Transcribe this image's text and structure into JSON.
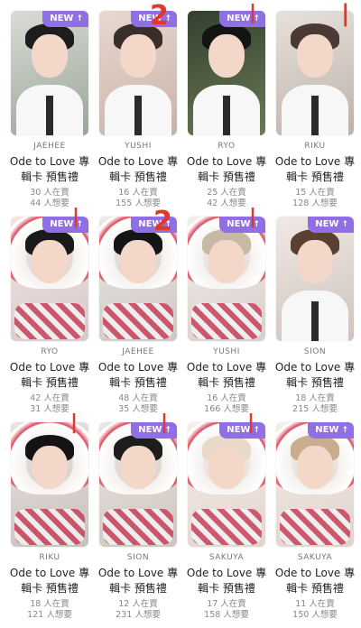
{
  "badge": {
    "label": "NEW",
    "icon": "arrow-up-icon",
    "color": "#8f6ee6"
  },
  "cards": [
    {
      "name": "JAEHEE",
      "title_line1": "Ode to Love 專",
      "title_line2": "輯卡 預售禮",
      "selling": "30 人在賣",
      "wanting": "44 人想要",
      "new": true
    },
    {
      "name": "YUSHI",
      "title_line1": "Ode to Love 專",
      "title_line2": "輯卡 預售禮",
      "selling": "16 人在賣",
      "wanting": "155 人想要",
      "new": true,
      "annotation": "2"
    },
    {
      "name": "RYO",
      "title_line1": "Ode to Love 專",
      "title_line2": "輯卡 預售禮",
      "selling": "25 人在賣",
      "wanting": "42 人想要",
      "new": true,
      "annotation": "|"
    },
    {
      "name": "RIKU",
      "title_line1": "Ode to Love 專",
      "title_line2": "輯卡 預售禮",
      "selling": "15 人在賣",
      "wanting": "128 人想要",
      "new": false,
      "annotation": "|"
    },
    {
      "name": "RYO",
      "title_line1": "Ode to Love 專",
      "title_line2": "輯卡 預售禮",
      "selling": "42 人在賣",
      "wanting": "31 人想要",
      "new": true,
      "annotation": "|"
    },
    {
      "name": "JAEHEE",
      "title_line1": "Ode to Love 專",
      "title_line2": "輯卡 預售禮",
      "selling": "48 人在賣",
      "wanting": "35 人想要",
      "new": true,
      "annotation": "2"
    },
    {
      "name": "YUSHI",
      "title_line1": "Ode to Love 專",
      "title_line2": "輯卡 預售禮",
      "selling": "16 人在賣",
      "wanting": "166 人想要",
      "new": true,
      "annotation": "|"
    },
    {
      "name": "SION",
      "title_line1": "Ode to Love 專",
      "title_line2": "輯卡 預售禮",
      "selling": "18 人在賣",
      "wanting": "215 人想要",
      "new": true
    },
    {
      "name": "RIKU",
      "title_line1": "Ode to Love 專",
      "title_line2": "輯卡 預售禮",
      "selling": "18 人在賣",
      "wanting": "121 人想要",
      "new": false,
      "annotation": "|"
    },
    {
      "name": "SION",
      "title_line1": "Ode to Love 專",
      "title_line2": "輯卡 預售禮",
      "selling": "12 人在賣",
      "wanting": "231 人想要",
      "new": true,
      "annotation": "|"
    },
    {
      "name": "SAKUYA",
      "title_line1": "Ode to Love 專",
      "title_line2": "輯卡 預售禮",
      "selling": "17 人在賣",
      "wanting": "158 人想要",
      "new": true,
      "annotation": "|"
    },
    {
      "name": "SAKUYA",
      "title_line1": "Ode to Love 專",
      "title_line2": "輯卡 預售禮",
      "selling": "11 人在賣",
      "wanting": "150 人想要",
      "new": true
    }
  ]
}
